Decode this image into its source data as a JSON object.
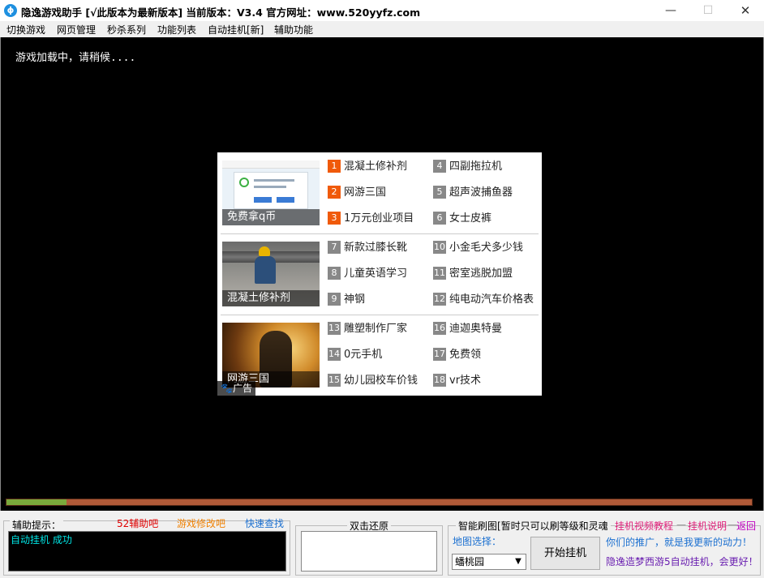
{
  "window": {
    "title": "隐逸游戏助手 [√此版本为最新版本] 当前版本：V3.4 官方网址：www.520yyfz.com",
    "min_glyph": "—",
    "max_glyph": "☐",
    "close_glyph": "✕"
  },
  "menu": [
    "切换游戏",
    "网页管理",
    "秒杀系列",
    "功能列表",
    "自动挂机[新]",
    "辅助功能"
  ],
  "game": {
    "loading": "游戏加载中，请稍候...."
  },
  "ad": {
    "thumbs": [
      "免费拿q币",
      "混凝土修补剂",
      "网游三国"
    ],
    "badge": "🐾广告",
    "links": [
      {
        "num": "1",
        "text": "混凝土修补剂",
        "hot": true
      },
      {
        "num": "2",
        "text": "网游三国",
        "hot": true
      },
      {
        "num": "3",
        "text": "1万元创业项目",
        "hot": true
      },
      {
        "num": "4",
        "text": "四副拖拉机",
        "hot": false
      },
      {
        "num": "5",
        "text": "超声波捕鱼器",
        "hot": false
      },
      {
        "num": "6",
        "text": "女士皮裤",
        "hot": false
      },
      {
        "num": "7",
        "text": "新款过膝长靴",
        "hot": false
      },
      {
        "num": "8",
        "text": "儿童英语学习",
        "hot": false
      },
      {
        "num": "9",
        "text": "神钢",
        "hot": false
      },
      {
        "num": "10",
        "text": "小金毛犬多少钱",
        "hot": false
      },
      {
        "num": "11",
        "text": "密室逃脱加盟",
        "hot": false
      },
      {
        "num": "12",
        "text": "纯电动汽车价格表",
        "hot": false
      },
      {
        "num": "13",
        "text": "雕塑制作厂家",
        "hot": false
      },
      {
        "num": "14",
        "text": "0元手机",
        "hot": false
      },
      {
        "num": "15",
        "text": "幼儿园校车价钱",
        "hot": false
      },
      {
        "num": "16",
        "text": "迪迦奥特曼",
        "hot": false
      },
      {
        "num": "17",
        "text": "免费领",
        "hot": false
      },
      {
        "num": "18",
        "text": "vr技术",
        "hot": false
      }
    ]
  },
  "progress": {
    "fraction": 0.081
  },
  "assist": {
    "legend": "辅助提示：",
    "links": [
      {
        "text": "52辅助吧",
        "color": "#e00000"
      },
      {
        "text": "游戏修改吧",
        "color": "#f08000"
      },
      {
        "text": "快速查找",
        "color": "#1a6fd0"
      }
    ],
    "status": "自动挂机 成功"
  },
  "restore": {
    "legend": "双击还原"
  },
  "smart": {
    "legend": "智能刷图[暂时只可以刷等级和灵魂",
    "links": [
      {
        "text": "挂机视频教程",
        "color": "#e0207a"
      },
      {
        "text": "挂机说明",
        "color": "#e0207a"
      },
      {
        "text": "返回",
        "color": "#c000c0"
      }
    ],
    "separators": [
      "—",
      "—"
    ],
    "map_label": "地图选择：",
    "map_value": "蟠桃园",
    "start_button": "开始挂机",
    "promo1": "你们的推广，就是我更新的动力！",
    "promo2": "隐逸造梦西游5自动挂机，会更好！"
  },
  "colors": {
    "hot_num": "#f05a0a",
    "norm_num": "#888888",
    "status_text": "#00e5e5",
    "progress_fill": "#7aaa3c",
    "progress_track": "#b05a38"
  }
}
